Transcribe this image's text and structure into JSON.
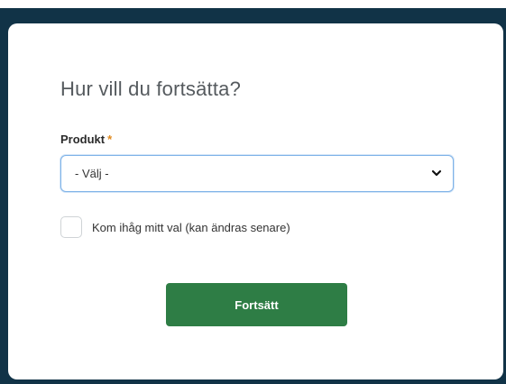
{
  "dialog": {
    "title": "Hur vill du fortsätta?",
    "product_field": {
      "label": "Produkt",
      "required_marker": "*",
      "selected_value": "- Välj -"
    },
    "remember_choice": {
      "label": "Kom ihåg mitt val (kan ändras senare)",
      "checked": false
    },
    "continue_button": {
      "label": "Fortsätt"
    }
  },
  "colors": {
    "backdrop": "#113347",
    "primary_button": "#2e7d45",
    "required_star": "#e08a1e",
    "select_focus_border": "#7fb3e8"
  },
  "icons": {
    "select_dropdown": "chevron-down-icon"
  }
}
